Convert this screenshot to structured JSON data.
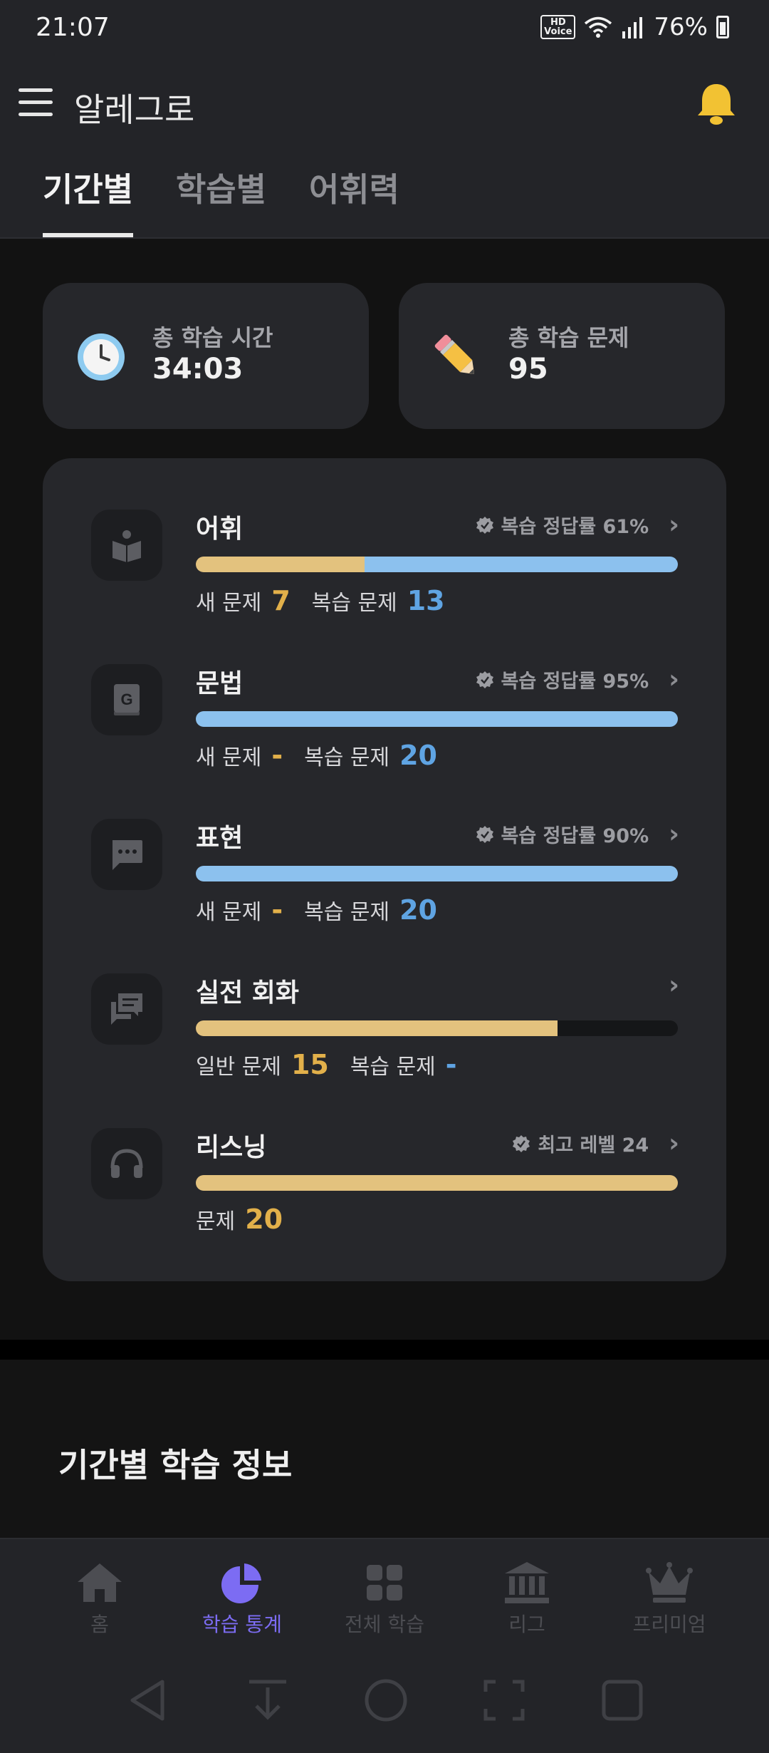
{
  "status_bar": {
    "time": "21:07",
    "battery": "76%",
    "hd_voice": "HD\nVoice"
  },
  "header": {
    "app_title": "알레그로",
    "tabs": [
      {
        "label": "기간별",
        "active": true
      },
      {
        "label": "학습별",
        "active": false
      },
      {
        "label": "어휘력",
        "active": false
      }
    ]
  },
  "summary": {
    "time_label": "총 학습 시간",
    "time_value": "34:03",
    "problems_label": "총 학습 문제",
    "problems_value": "95"
  },
  "stats": [
    {
      "title": "어휘",
      "badge": "복습 정답률 61%",
      "new_label": "새 문제",
      "new_value": "7",
      "review_label": "복습 문제",
      "review_value": "13",
      "new_fraction": 0.35,
      "review_fraction": 0.65
    },
    {
      "title": "문법",
      "badge": "복습 정답률 95%",
      "new_label": "새 문제",
      "new_value": "-",
      "review_label": "복습 문제",
      "review_value": "20",
      "new_fraction": 0,
      "review_fraction": 1.0
    },
    {
      "title": "표현",
      "badge": "복습 정답률 90%",
      "new_label": "새 문제",
      "new_value": "-",
      "review_label": "복습 문제",
      "review_value": "20",
      "new_fraction": 0,
      "review_fraction": 1.0
    },
    {
      "title": "실전 회화",
      "badge": "",
      "new_label": "일반 문제",
      "new_value": "15",
      "review_label": "복습 문제",
      "review_value": "-",
      "new_fraction": 0.75,
      "review_fraction": 0
    },
    {
      "title": "리스닝",
      "badge": "최고 레벨 24",
      "new_label": "문제",
      "new_value": "20",
      "review_label": "",
      "review_value": "",
      "new_fraction": 1.0,
      "review_fraction": 0
    }
  ],
  "section": {
    "title": "기간별 학습 정보"
  },
  "bottom_nav": [
    {
      "label": "홈",
      "icon": "home-icon",
      "active": false
    },
    {
      "label": "학습 통계",
      "icon": "pie-chart-icon",
      "active": true
    },
    {
      "label": "전체 학습",
      "icon": "grid-icon",
      "active": false
    },
    {
      "label": "리그",
      "icon": "bank-icon",
      "active": false
    },
    {
      "label": "프리미엄",
      "icon": "crown-icon",
      "active": false
    }
  ],
  "colors": {
    "accent": "#7c6cf3",
    "new_bar": "#e3c27e",
    "review_bar": "#8cc1ee",
    "new_count": "#e2b04a",
    "review_count": "#5fa4e3",
    "bell": "#f2c233"
  }
}
